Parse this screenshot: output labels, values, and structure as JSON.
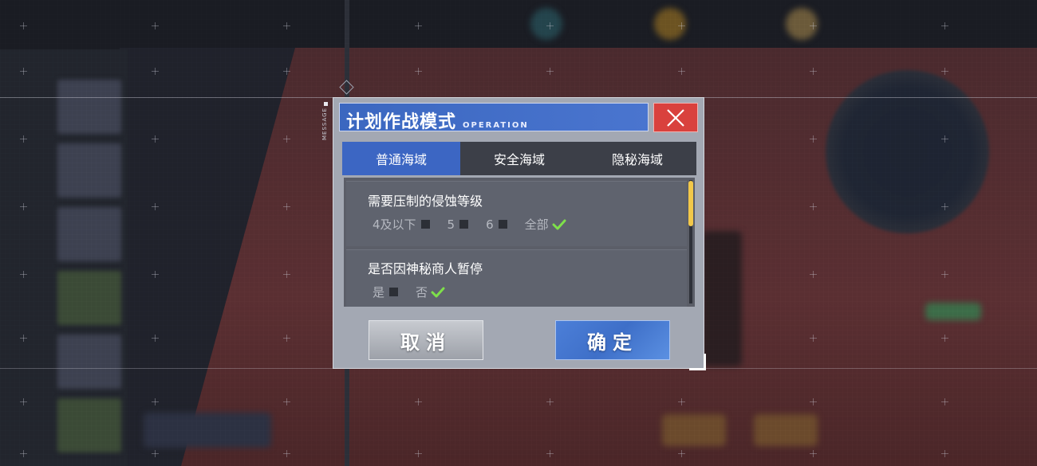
{
  "background": {
    "message_label": "MESSAGE"
  },
  "dialog": {
    "title": "计划作战模式",
    "subtitle": "OPERATION",
    "close_icon": "close-icon",
    "tabs": [
      {
        "label": "普通海域",
        "active": true
      },
      {
        "label": "安全海域",
        "active": false
      },
      {
        "label": "隐秘海域",
        "active": false
      }
    ],
    "sections": [
      {
        "title": "需要压制的侵蚀等级",
        "options": [
          {
            "label": "4及以下",
            "checked": false
          },
          {
            "label": "5",
            "checked": false
          },
          {
            "label": "6",
            "checked": false
          },
          {
            "label": "全部",
            "checked": true
          }
        ]
      },
      {
        "title": "是否因神秘商人暂停",
        "options": [
          {
            "label": "是",
            "checked": false
          },
          {
            "label": "否",
            "checked": true
          }
        ]
      }
    ],
    "cancel_label": "取消",
    "confirm_label": "确定",
    "colors": {
      "accent_blue": "#3c66c3",
      "close_red": "#d9413d",
      "check_green": "#7ee04a",
      "scroll_thumb": "#f2c84a"
    }
  }
}
